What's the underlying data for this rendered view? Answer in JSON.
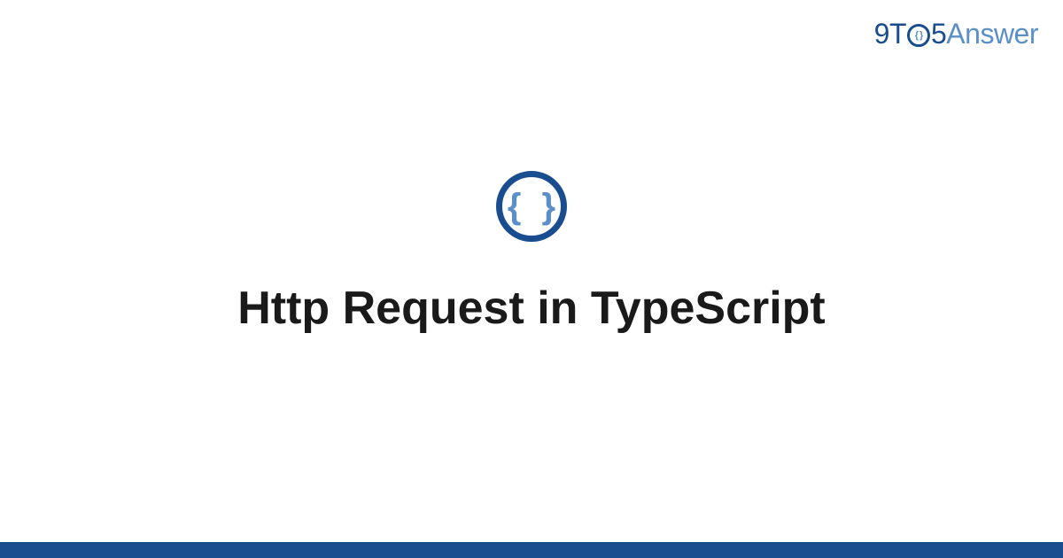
{
  "logo": {
    "part1": "9T",
    "part_o_inner": "{ }",
    "part2": "5",
    "part3": "Answer"
  },
  "icon": {
    "braces": "{ }"
  },
  "title": "Http Request in TypeScript"
}
